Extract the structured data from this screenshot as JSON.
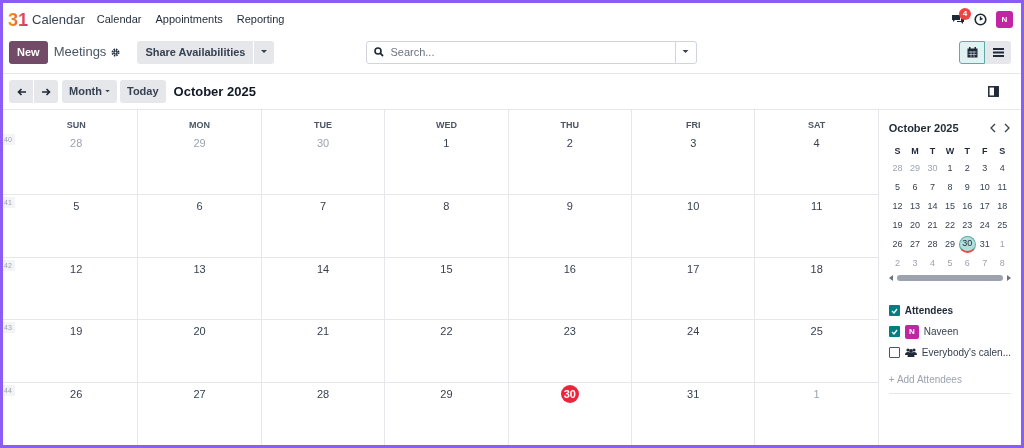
{
  "app": {
    "logo": "31",
    "name": "Calendar"
  },
  "menu": [
    "Calendar",
    "Appointments",
    "Reporting"
  ],
  "systray": {
    "messages_badge": "4",
    "avatar": "N"
  },
  "control": {
    "new_button": "New",
    "breadcrumb": "Meetings",
    "share_button": "Share Availabilities",
    "search_placeholder": "Search...",
    "views": [
      {
        "kind": "calendar",
        "selected": true
      },
      {
        "kind": "list",
        "selected": false
      }
    ]
  },
  "navigation": {
    "scale": "Month",
    "today_button": "Today",
    "title": "October 2025"
  },
  "grid": {
    "weekdays": [
      "SUN",
      "MON",
      "TUE",
      "WED",
      "THU",
      "FRI",
      "SAT"
    ],
    "weeks": [
      {
        "number": "40",
        "days": [
          {
            "label": "28",
            "outside": true,
            "today": false
          },
          {
            "label": "29",
            "outside": true,
            "today": false
          },
          {
            "label": "30",
            "outside": true,
            "today": false
          },
          {
            "label": "1",
            "outside": false,
            "today": false
          },
          {
            "label": "2",
            "outside": false,
            "today": false
          },
          {
            "label": "3",
            "outside": false,
            "today": false
          },
          {
            "label": "4",
            "outside": false,
            "today": false
          }
        ]
      },
      {
        "number": "41",
        "days": [
          {
            "label": "5",
            "outside": false,
            "today": false
          },
          {
            "label": "6",
            "outside": false,
            "today": false
          },
          {
            "label": "7",
            "outside": false,
            "today": false
          },
          {
            "label": "8",
            "outside": false,
            "today": false
          },
          {
            "label": "9",
            "outside": false,
            "today": false
          },
          {
            "label": "10",
            "outside": false,
            "today": false
          },
          {
            "label": "11",
            "outside": false,
            "today": false
          }
        ]
      },
      {
        "number": "42",
        "days": [
          {
            "label": "12",
            "outside": false,
            "today": false
          },
          {
            "label": "13",
            "outside": false,
            "today": false
          },
          {
            "label": "14",
            "outside": false,
            "today": false
          },
          {
            "label": "15",
            "outside": false,
            "today": false
          },
          {
            "label": "16",
            "outside": false,
            "today": false
          },
          {
            "label": "17",
            "outside": false,
            "today": false
          },
          {
            "label": "18",
            "outside": false,
            "today": false
          }
        ]
      },
      {
        "number": "43",
        "days": [
          {
            "label": "19",
            "outside": false,
            "today": false
          },
          {
            "label": "20",
            "outside": false,
            "today": false
          },
          {
            "label": "21",
            "outside": false,
            "today": false
          },
          {
            "label": "22",
            "outside": false,
            "today": false
          },
          {
            "label": "23",
            "outside": false,
            "today": false
          },
          {
            "label": "24",
            "outside": false,
            "today": false
          },
          {
            "label": "25",
            "outside": false,
            "today": false
          }
        ]
      },
      {
        "number": "44",
        "days": [
          {
            "label": "26",
            "outside": false,
            "today": false
          },
          {
            "label": "27",
            "outside": false,
            "today": false
          },
          {
            "label": "28",
            "outside": false,
            "today": false
          },
          {
            "label": "29",
            "outside": false,
            "today": false
          },
          {
            "label": "30",
            "outside": false,
            "today": true
          },
          {
            "label": "31",
            "outside": false,
            "today": false
          },
          {
            "label": "1",
            "outside": true,
            "today": false
          }
        ]
      }
    ]
  },
  "mini_calendar": {
    "title": "October 2025",
    "weekdays": [
      "S",
      "M",
      "T",
      "W",
      "T",
      "F",
      "S"
    ],
    "weeks": [
      [
        {
          "label": "28",
          "outside": true,
          "selected": false
        },
        {
          "label": "29",
          "outside": true,
          "selected": false
        },
        {
          "label": "30",
          "outside": true,
          "selected": false
        },
        {
          "label": "1",
          "outside": false,
          "selected": false
        },
        {
          "label": "2",
          "outside": false,
          "selected": false
        },
        {
          "label": "3",
          "outside": false,
          "selected": false
        },
        {
          "label": "4",
          "outside": false,
          "selected": false
        }
      ],
      [
        {
          "label": "5",
          "outside": false,
          "selected": false
        },
        {
          "label": "6",
          "outside": false,
          "selected": false
        },
        {
          "label": "7",
          "outside": false,
          "selected": false
        },
        {
          "label": "8",
          "outside": false,
          "selected": false
        },
        {
          "label": "9",
          "outside": false,
          "selected": false
        },
        {
          "label": "10",
          "outside": false,
          "selected": false
        },
        {
          "label": "11",
          "outside": false,
          "selected": false
        }
      ],
      [
        {
          "label": "12",
          "outside": false,
          "selected": false
        },
        {
          "label": "13",
          "outside": false,
          "selected": false
        },
        {
          "label": "14",
          "outside": false,
          "selected": false
        },
        {
          "label": "15",
          "outside": false,
          "selected": false
        },
        {
          "label": "16",
          "outside": false,
          "selected": false
        },
        {
          "label": "17",
          "outside": false,
          "selected": false
        },
        {
          "label": "18",
          "outside": false,
          "selected": false
        }
      ],
      [
        {
          "label": "19",
          "outside": false,
          "selected": false
        },
        {
          "label": "20",
          "outside": false,
          "selected": false
        },
        {
          "label": "21",
          "outside": false,
          "selected": false
        },
        {
          "label": "22",
          "outside": false,
          "selected": false
        },
        {
          "label": "23",
          "outside": false,
          "selected": false
        },
        {
          "label": "24",
          "outside": false,
          "selected": false
        },
        {
          "label": "25",
          "outside": false,
          "selected": false
        }
      ],
      [
        {
          "label": "26",
          "outside": false,
          "selected": false
        },
        {
          "label": "27",
          "outside": false,
          "selected": false
        },
        {
          "label": "28",
          "outside": false,
          "selected": false
        },
        {
          "label": "29",
          "outside": false,
          "selected": false
        },
        {
          "label": "30",
          "outside": false,
          "selected": true
        },
        {
          "label": "31",
          "outside": false,
          "selected": false
        },
        {
          "label": "1",
          "outside": true,
          "selected": false
        }
      ],
      [
        {
          "label": "2",
          "outside": true,
          "selected": false
        },
        {
          "label": "3",
          "outside": true,
          "selected": false
        },
        {
          "label": "4",
          "outside": true,
          "selected": false
        },
        {
          "label": "5",
          "outside": true,
          "selected": false
        },
        {
          "label": "6",
          "outside": true,
          "selected": false
        },
        {
          "label": "7",
          "outside": true,
          "selected": false
        },
        {
          "label": "8",
          "outside": true,
          "selected": false
        }
      ]
    ]
  },
  "filters": [
    {
      "kind": "group",
      "label": "Attendees",
      "checked": true
    },
    {
      "kind": "user",
      "label": "Naveen",
      "avatar": "N",
      "checked": true
    },
    {
      "kind": "everybody",
      "label": "Everybody's calen...",
      "checked": false
    }
  ],
  "add_attendees": "+ Add Attendees"
}
